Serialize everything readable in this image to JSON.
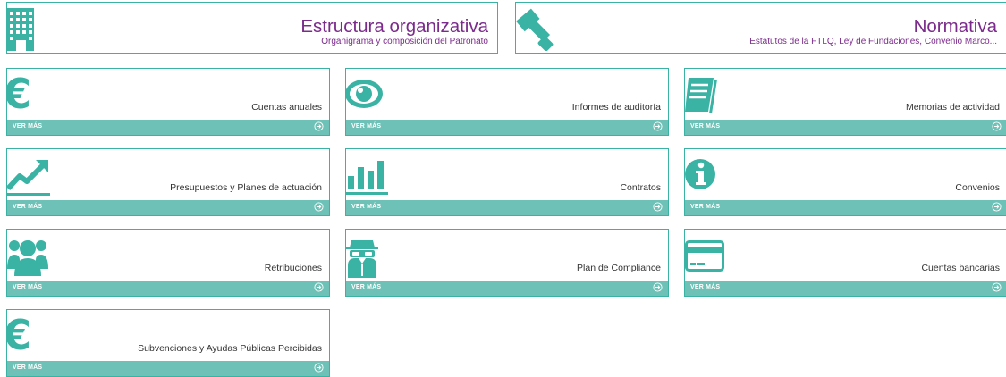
{
  "colors": {
    "teal": "#3ab3a5",
    "footer": "#6ec1b6",
    "purple": "#7b2b8b",
    "text": "#333333"
  },
  "featured": [
    {
      "title": "Estructura organizativa",
      "subtitle": "Organigrama y composición del Patronato",
      "icon": "building-icon"
    },
    {
      "title": "Normativa",
      "subtitle": "Estatutos de la FTLQ, Ley de Fundaciones, Convenio Marco...",
      "icon": "gavel-icon"
    }
  ],
  "cards": [
    {
      "label": "Cuentas anuales",
      "icon": "euro-icon",
      "more": "VER MÁS"
    },
    {
      "label": "Informes de auditoría",
      "icon": "eye-icon",
      "more": "VER MÁS"
    },
    {
      "label": "Memorias de actividad",
      "icon": "notebook-icon",
      "more": "VER MÁS"
    },
    {
      "label": "Presupuestos y Planes de actuación",
      "icon": "trend-up-icon",
      "more": "VER MÁS"
    },
    {
      "label": "Contratos",
      "icon": "bar-chart-icon",
      "more": "VER MÁS"
    },
    {
      "label": "Convenios",
      "icon": "info-icon",
      "more": "VER MÁS"
    },
    {
      "label": "Retribuciones",
      "icon": "people-icon",
      "more": "VER MÁS"
    },
    {
      "label": "Plan de Compliance",
      "icon": "spy-icon",
      "more": "VER MÁS"
    },
    {
      "label": "Cuentas bancarias",
      "icon": "credit-card-icon",
      "more": "VER MÁS"
    },
    {
      "label": "Subvenciones y Ayudas Públicas Percibidas",
      "icon": "euro-icon",
      "more": "VER MÁS"
    }
  ]
}
